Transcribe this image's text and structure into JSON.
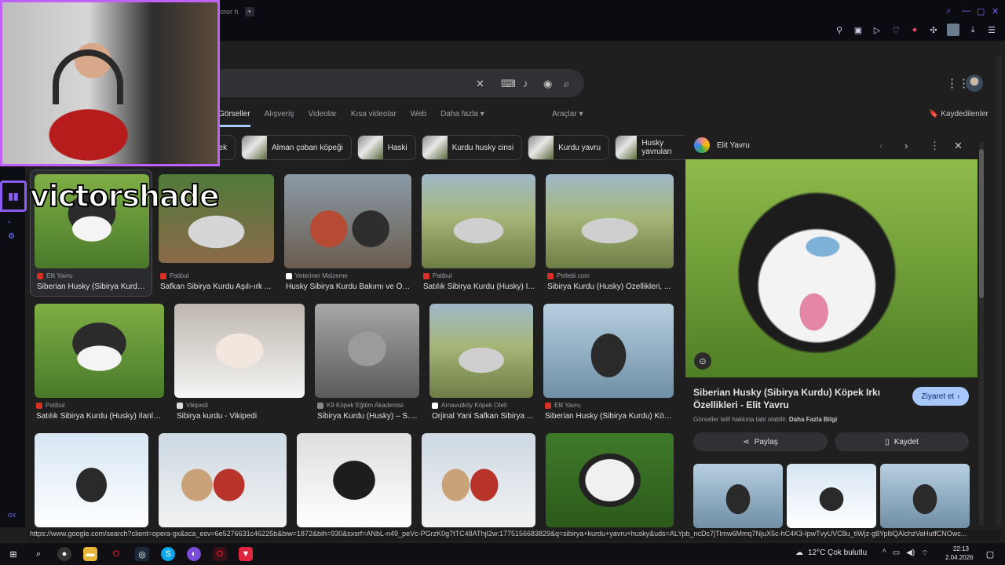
{
  "browser": {
    "tab_fragment": "oror h",
    "new_tab": "+"
  },
  "search": {
    "tabs": [
      "Görseller",
      "Alışveriş",
      "Videolar",
      "Kısa videolar",
      "Web",
      "Daha fazla ▾"
    ],
    "tools": "Araçlar ▾",
    "saved": "Kaydedilenler"
  },
  "chips": [
    "pek",
    "Alman çoban köpeği",
    "Haski",
    "Kurdu husky cinsi",
    "Kurdu yavru",
    "Husky yavruları"
  ],
  "results": [
    {
      "source": "Elit Yavru",
      "title": "Siberian Husky (Sibirya Kurdu..."
    },
    {
      "source": "Patibul",
      "title": "Safkan Sibirya Kurdu Aşılı-ırk ..."
    },
    {
      "source": "Veteriner Malzeme",
      "title": "Husky Sibirya Kurdu Bakımı ve Öz..."
    },
    {
      "source": "Patibul",
      "title": "Satılık Sibirya Kurdu (Husky) İ..."
    },
    {
      "source": "Petlebi.com",
      "title": "Sibirya Kurdu (Husky) Özellikleri, ..."
    },
    {
      "source": "Patibul",
      "title": "Satılık Sibirya Kurdu (Husky) İlanla..."
    },
    {
      "source": "Vikipedi",
      "title": "Sibirya kurdu - Vikipedi"
    },
    {
      "source": "K9 Köpek Eğitim Akademisi",
      "title": "Sibirya Kurdu (Husky) – S.I.R"
    },
    {
      "source": "Arnavutköy Köpek Oteli",
      "title": "Orjinal Yani Safkan Sibirya ..."
    },
    {
      "source": "Elit Yavru",
      "title": "Siberian Husky (Sibirya Kurdu) Köp..."
    }
  ],
  "panel": {
    "site": "Elit Yavru",
    "title": "Siberian Husky (Sibirya Kurdu) Köpek Irkı Özellikleri - Elit Yavru",
    "visit": "Ziyaret et",
    "copyright_prefix": "Görseller telif hakkına tabi olabilir.",
    "copyright_link": "Daha Fazla Bilgi",
    "share": "Paylaş",
    "save": "Kaydet"
  },
  "status_url": "https://www.google.com/search?client=opera-gx&sca_esv=6e5276631c46225b&biw=1872&bih=930&sxsrf=ANbL-n49_peVc-PGrzK0g7tTC48AThjI2w:1775156683829&q=sibirya+kurdu+yavru+husky&uds=ALYpb_ncDc7jTlmw6Mmq7NjuX5c-hC4K3-IpwTvyUVC8u_tiWjz-g8YpltiQAlchzVaHutfCNOwc...",
  "taskbar": {
    "weather": "12°C  Çok bulutlu",
    "time": "22:13",
    "date": "2.04.2026"
  },
  "overlay": {
    "streamer": "victorshade"
  },
  "colors": {
    "accent": "#a8c7fa",
    "stream_border": "#c061ff",
    "opera_red": "#ff1b2d"
  }
}
